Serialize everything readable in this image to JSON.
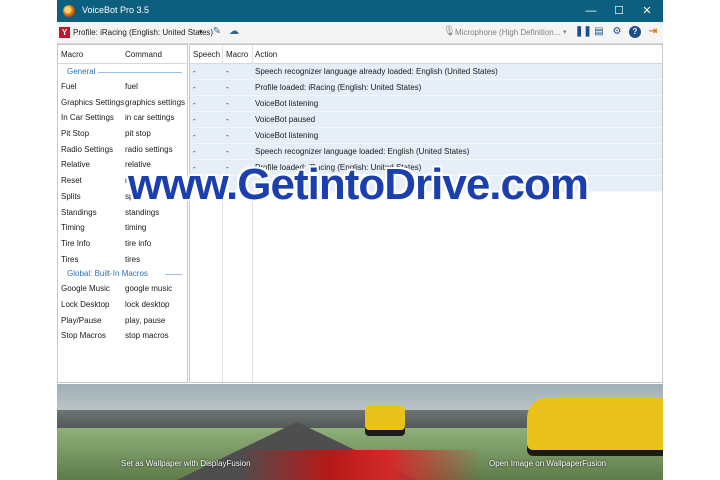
{
  "window": {
    "title": "VoiceBot Pro 3.5",
    "minimize": "—",
    "maximize": "☐",
    "close": "✕"
  },
  "toolbar": {
    "profile_label": "Profile: iRacing (English: United States)",
    "dropdown_arrow": "▾",
    "microphone": "Microphone (High Definition...",
    "mic_dropdown": "▾"
  },
  "left": {
    "col_macro": "Macro",
    "col_command": "Command",
    "groups": [
      {
        "name": "General",
        "items": [
          {
            "macro": "Fuel",
            "command": "fuel"
          },
          {
            "macro": "Graphics Settings",
            "command": "graphics settings"
          },
          {
            "macro": "In Car Settings",
            "command": "in car settings"
          },
          {
            "macro": "Pit Stop",
            "command": "pit stop"
          },
          {
            "macro": "Radio Settings",
            "command": "radio settings"
          },
          {
            "macro": "Relative",
            "command": "relative"
          },
          {
            "macro": "Reset",
            "command": "r"
          },
          {
            "macro": "Splits",
            "command": "sp"
          },
          {
            "macro": "Standings",
            "command": "standings"
          },
          {
            "macro": "Timing",
            "command": "timing"
          },
          {
            "macro": "Tire Info",
            "command": "tire info"
          },
          {
            "macro": "Tires",
            "command": "tires"
          }
        ]
      },
      {
        "name": "Global: Built-In Macros",
        "items": [
          {
            "macro": "Google Music",
            "command": "google music"
          },
          {
            "macro": "Lock Desktop",
            "command": "lock desktop"
          },
          {
            "macro": "Play/Pause",
            "command": "play, pause"
          },
          {
            "macro": "Stop Macros",
            "command": "stop macros"
          }
        ]
      }
    ]
  },
  "log": {
    "col_speech": "Speech",
    "col_macro": "Macro",
    "col_action": "Action",
    "rows": [
      {
        "speech": "-",
        "macro": "-",
        "action": "Speech recognizer language already loaded: English (United States)"
      },
      {
        "speech": "-",
        "macro": "-",
        "action": "Profile loaded: iRacing (English: United States)"
      },
      {
        "speech": "-",
        "macro": "-",
        "action": "VoiceBot listening"
      },
      {
        "speech": "-",
        "macro": "-",
        "action": "VoiceBot paused"
      },
      {
        "speech": "-",
        "macro": "-",
        "action": "VoiceBot listening"
      },
      {
        "speech": "-",
        "macro": "-",
        "action": "Speech recognizer language loaded: English (United States)"
      },
      {
        "speech": "-",
        "macro": "-",
        "action": "Profile loaded: iRacing (English: United States)"
      },
      {
        "speech": "-",
        "macro": "-",
        "action": ""
      }
    ]
  },
  "wallpaper": {
    "left_link": "Set as Wallpaper with DisplayFusion",
    "right_link": "Open Image on WallpaperFusion"
  },
  "watermark": "www.GetintoDrive.com",
  "colors": {
    "titlebar": "#0d5f7f",
    "group_header": "#2f6fb6",
    "log_row_bg": "#e6eef8",
    "watermark": "#1c3fae"
  },
  "icons": [
    "app-icon",
    "profile-icon",
    "edit-icon",
    "cloud-icon",
    "microphone-icon",
    "pause-icon",
    "console-icon",
    "settings-icon",
    "help-icon",
    "exit-icon"
  ]
}
